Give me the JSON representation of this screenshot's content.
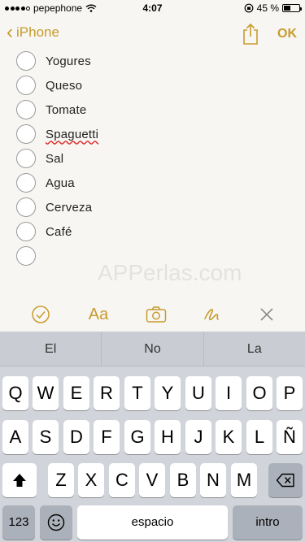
{
  "status_bar": {
    "carrier": "pepephone",
    "time": "4:07",
    "battery_percent": "45 %",
    "battery_level": 0.45
  },
  "nav": {
    "back_label": "iPhone",
    "done_label": "OK"
  },
  "checklist": {
    "items": [
      "Yogures",
      "Queso",
      "Tomate",
      "Spaguetti",
      "Sal",
      "Agua",
      "Cerveza",
      "Café",
      ""
    ]
  },
  "watermark": "APPerlas.com",
  "note_toolbar": {
    "icons": [
      "checkmark-circle-icon",
      "text-format-icon",
      "camera-icon",
      "sketch-icon",
      "close-icon"
    ],
    "format_label": "Aa"
  },
  "keyboard": {
    "predictions": [
      "El",
      "No",
      "La"
    ],
    "row1": [
      "Q",
      "W",
      "E",
      "R",
      "T",
      "Y",
      "U",
      "I",
      "O",
      "P"
    ],
    "row2": [
      "A",
      "S",
      "D",
      "F",
      "G",
      "H",
      "J",
      "K",
      "L",
      "Ñ"
    ],
    "row3": [
      "Z",
      "X",
      "C",
      "V",
      "B",
      "N",
      "M"
    ],
    "numbers_label": "123",
    "space_label": "espacio",
    "return_label": "intro"
  },
  "colors": {
    "accent": "#c89b2c"
  }
}
